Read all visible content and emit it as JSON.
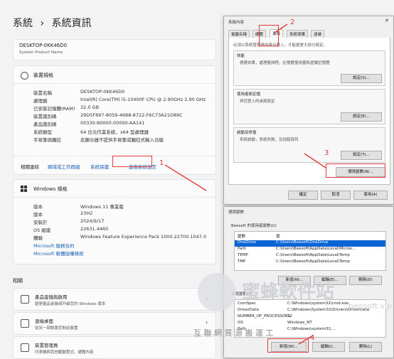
{
  "page": {
    "breadcrumb_parent": "系統",
    "breadcrumb_sep": "›",
    "breadcrumb_current": "系統資訊"
  },
  "device": {
    "name": "DESKTOP-0KK46D0",
    "subtitle": "System Product Name"
  },
  "device_spec": {
    "header": "裝置規格",
    "rows": [
      {
        "label": "裝置名稱",
        "value": "DESKTOP-0KK46D0"
      },
      {
        "label": "處理器",
        "value": "Intel(R) Core(TM) i5-10400F CPU @ 2.90GHz   2.90 GHz"
      },
      {
        "label": "已安裝記憶體(RAM)",
        "value": "32.0 GB"
      },
      {
        "label": "裝置識別碼",
        "value": "29D5F897-8059-4688-8722-F6C73A21D89C"
      },
      {
        "label": "產品識別碼",
        "value": "00330-80000-00000-AA141"
      },
      {
        "label": "系統類型",
        "value": "64 位元作業系統，x64 型處理器"
      },
      {
        "label": "手寫筆與觸控",
        "value": "此顯示器不提供手寫筆或觸控式輸入功能"
      }
    ]
  },
  "related_links": {
    "label": "相關連結",
    "items": [
      "網域或工作群組",
      "系統保護",
      "進階系統設定"
    ]
  },
  "windows_spec": {
    "header": "Windows 規格",
    "rows": [
      {
        "label": "版本",
        "value": "Windows 11 專業版"
      },
      {
        "label": "版本",
        "value": "23H2"
      },
      {
        "label": "安裝於",
        "value": "2024/9/17"
      },
      {
        "label": "OS 組建",
        "value": "22631.4460"
      },
      {
        "label": "體驗",
        "value": "Windows Feature Experience Pack 1000.22700.1047.0"
      }
    ],
    "links": [
      "Microsoft 服務合約",
      "Microsoft 軟體授權條款"
    ]
  },
  "related": {
    "header": "相關",
    "items": [
      {
        "title": "產品金鑰與啟用",
        "desc": "變更產品金鑰或升級您的 Windows 版本"
      },
      {
        "title": "遠端桌面",
        "desc": "從另一部裝置控制此裝置"
      },
      {
        "title": "裝置管理員",
        "desc": "印表機與其他驅動程式，硬體內容"
      }
    ]
  },
  "sys_props": {
    "title": "系統內容",
    "tabs": [
      "電腦名稱",
      "硬體",
      "進階",
      "系統保護",
      "遠端"
    ],
    "active_tab": 2,
    "note": "必須以系統管理員的身分登入，才能變更大部分設定。",
    "groups": [
      {
        "title": "效能",
        "desc": "視覺效果，處理器排程，記憶體使用量和虛擬記憶體",
        "button": "設定(S)..."
      },
      {
        "title": "使用者設定檔",
        "desc": "與您登入的桌面設定",
        "button": "設定(E)..."
      },
      {
        "title": "啟動及修復",
        "desc": "系統啟動，系統失敗，及偵錯資訊",
        "button": "設定(T)..."
      }
    ],
    "env_button": "環境變數(N)...",
    "ok": "確定",
    "cancel": "取消",
    "apply": "套用(A)"
  },
  "env_vars": {
    "title": "環境變數",
    "user_caption": "Beesoft 的使用者變數(U)",
    "col_var": "變數",
    "col_val": "值",
    "user_rows": [
      {
        "var": "OneDrive",
        "val": "C:\\Users\\Beesoft\\OneDrive"
      },
      {
        "var": "Path",
        "val": "C:\\Users\\Beesoft\\AppData\\Local\\Micros..."
      },
      {
        "var": "TEMP",
        "val": "C:\\Users\\Beesoft\\AppData\\Local\\Temp"
      },
      {
        "var": "TMP",
        "val": "C:\\Users\\Beesoft\\AppData\\Local\\Temp"
      }
    ],
    "user_buttons": [
      "新增(N)...",
      "編輯(E)...",
      "刪除(D)"
    ],
    "sys_caption": "系統變數(S)",
    "sys_rows": [
      {
        "var": "ComSpec",
        "val": "C:\\Windows\\system32\\cmd.exe"
      },
      {
        "var": "DriverData",
        "val": "C:\\Windows\\System32\\Drivers\\DriverData"
      },
      {
        "var": "NUMBER_OF_PROCESSORS",
        "val": "12"
      },
      {
        "var": "OS",
        "val": "Windows_NT"
      },
      {
        "var": "Path",
        "val": "C:\\Windows\\system32;..."
      }
    ],
    "sys_buttons": [
      "新增(W)...",
      "編輯(I)...",
      "刪除(L)"
    ]
  },
  "annotations": [
    "1",
    "2",
    "3",
    "4"
  ],
  "watermark": {
    "brand": "蜜蜂軟件站",
    "url": "beesoft.vip",
    "slogan": "互 聯 網 質 源 搬 運 工"
  },
  "colors": {
    "annotation": "#e23b3b",
    "link": "#1a5fb4",
    "selection": "#0a64d6"
  }
}
